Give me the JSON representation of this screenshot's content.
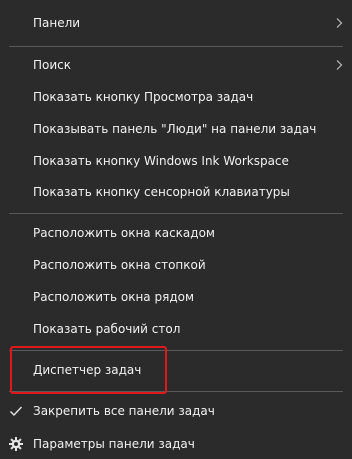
{
  "context_menu": {
    "items": [
      {
        "label": "Панели"
      },
      {
        "label": "Поиск"
      },
      {
        "label": "Показать кнопку Просмотра задач"
      },
      {
        "label": "Показывать панель \"Люди\" на панели задач"
      },
      {
        "label": "Показать кнопку Windows Ink Workspace"
      },
      {
        "label": "Показать кнопку сенсорной клавиатуры"
      },
      {
        "label": "Расположить окна каскадом"
      },
      {
        "label": "Расположить окна стопкой"
      },
      {
        "label": "Расположить окна рядом"
      },
      {
        "label": "Показать рабочий стол"
      },
      {
        "label": "Диспетчер задач"
      },
      {
        "label": "Закрепить все панели задач"
      },
      {
        "label": "Параметры панели задач"
      }
    ]
  },
  "theme": {
    "menu_bg": "#2b2b2b",
    "text": "#f2f2f2",
    "separator": "#5a5a5a",
    "highlight_border": "#e0181b"
  },
  "icons": {
    "submenu": "chevron-right-icon",
    "checked": "checkmark-icon",
    "settings": "gear-icon"
  }
}
